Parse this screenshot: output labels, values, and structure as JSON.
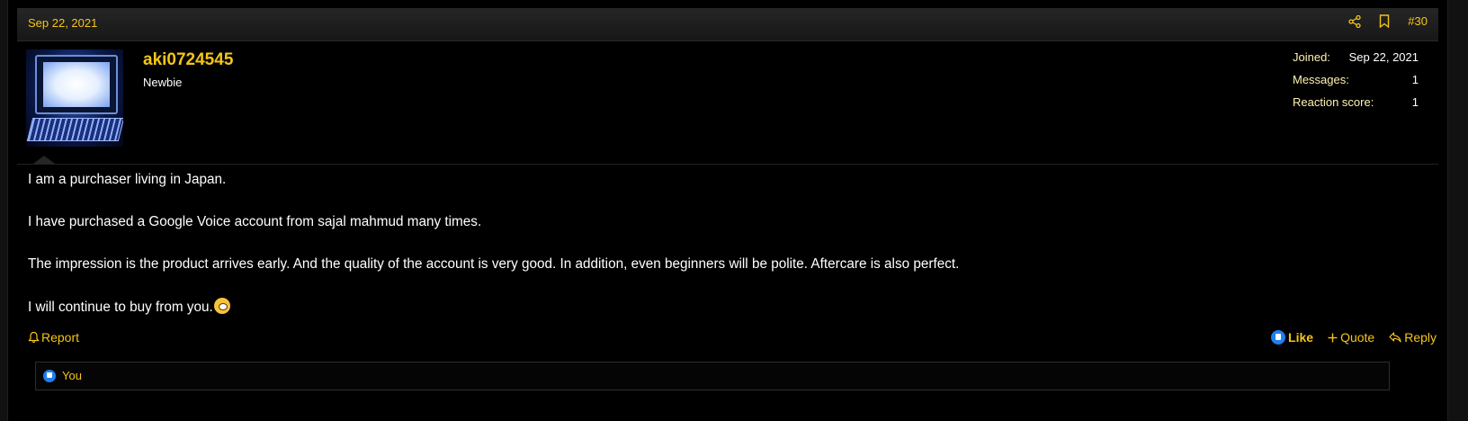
{
  "post": {
    "date": "Sep 22, 2021",
    "number": "#30"
  },
  "user": {
    "name": "aki0724545",
    "title": "Newbie",
    "stats": [
      {
        "label": "Joined:",
        "value": "Sep 22, 2021"
      },
      {
        "label": "Messages:",
        "value": "1"
      },
      {
        "label": "Reaction score:",
        "value": "1"
      }
    ]
  },
  "body": {
    "paragraphs": [
      "I am a purchaser living in Japan.",
      "I have purchased a Google Voice account from sajal mahmud many times.",
      "The impression is the product arrives early. And the quality of the account is very good. In addition, even beginners will be polite. Aftercare is also perfect.",
      "I will continue to buy from you."
    ]
  },
  "actions": {
    "report": "Report",
    "like": "Like",
    "quote": "Quote",
    "reply": "Reply"
  },
  "reactions": {
    "who": "You"
  },
  "icons": {
    "share": "share-icon",
    "bookmark": "bookmark-icon",
    "report": "bell-icon",
    "like": "thumbs-up-icon",
    "quote": "plus-icon",
    "reply": "reply-icon",
    "emoji": "smiling-face-emoji"
  },
  "colors": {
    "accent": "#f5c518",
    "background": "#000000",
    "like_blue": "#1e7ff0"
  }
}
